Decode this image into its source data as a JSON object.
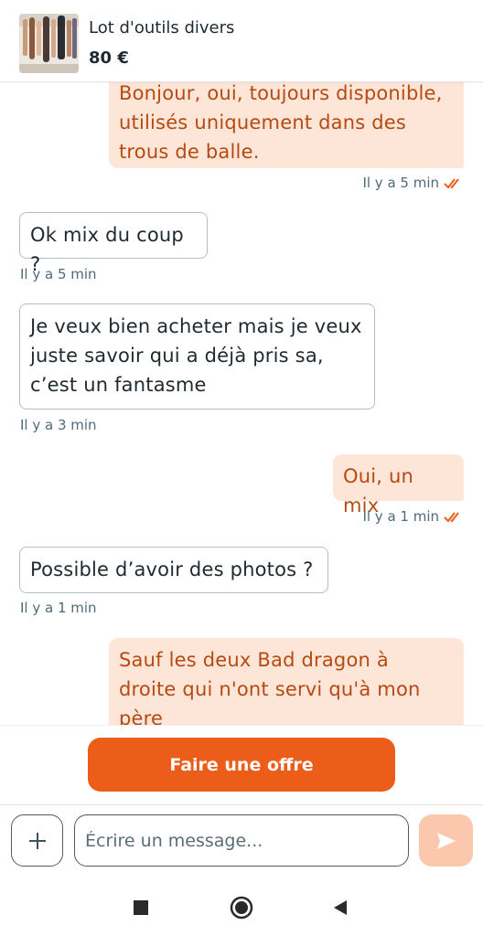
{
  "listing": {
    "title": "Lot d'outils divers",
    "price": "80 €",
    "thumbnail_icon": "listing-photo"
  },
  "messages": [
    {
      "from": "me",
      "lines": [
        "Bonjour, oui, toujours disponible,",
        "utilisés uniquement dans des",
        "trous de balle."
      ],
      "time": "Il y a 5 min",
      "read": true
    },
    {
      "from": "them",
      "lines": [
        "Ok mix du coup ?"
      ],
      "time": "Il y a 5 min"
    },
    {
      "from": "them",
      "lines": [
        "Je veux bien acheter mais je veux",
        "juste savoir qui a déjà pris sa,",
        "c’est un fantasme"
      ],
      "time": "Il y a 3 min"
    },
    {
      "from": "me",
      "lines": [
        "Oui, un mix"
      ],
      "time": "Il y a 1 min",
      "read": true
    },
    {
      "from": "them",
      "lines": [
        "Possible d’avoir des photos ?"
      ],
      "time": "Il y a 1 min"
    },
    {
      "from": "me",
      "lines": [
        "Sauf les deux Bad dragon à",
        "droite qui n'ont servi qu'à mon",
        "père"
      ]
    }
  ],
  "actions": {
    "offer_label": "Faire une offre",
    "message_placeholder": "Écrire un message...",
    "attach_icon": "plus-icon",
    "send_icon": "send-icon"
  },
  "colors": {
    "accent": "#ec5d1a",
    "my_bubble_bg": "#fde5d8",
    "my_bubble_text": "#b64a10",
    "send_disabled": "#fbc7ad"
  }
}
